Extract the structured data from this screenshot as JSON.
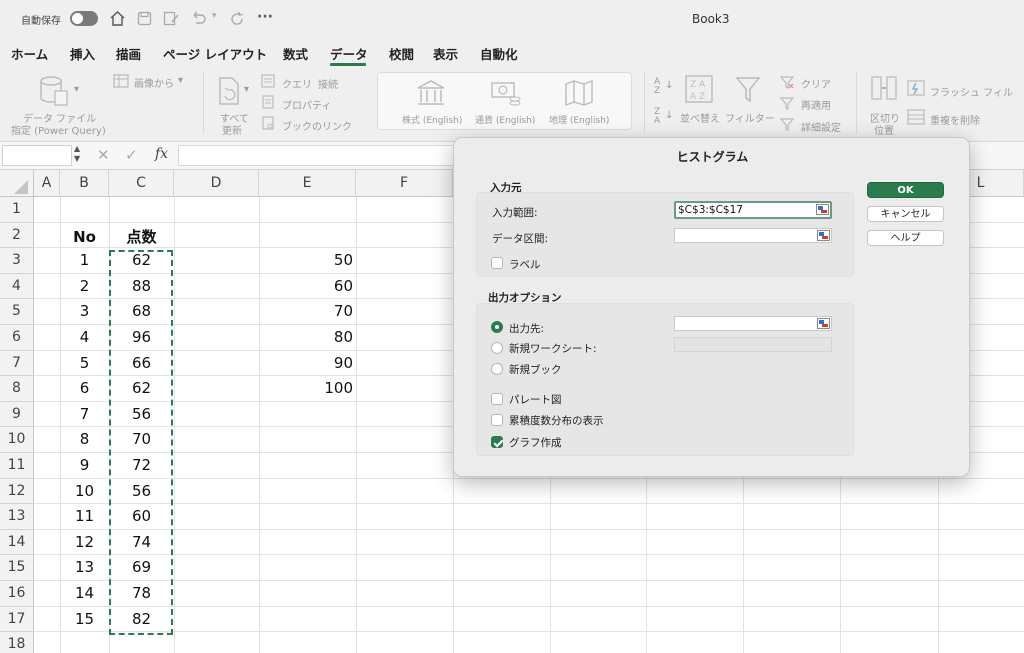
{
  "titlebar": {
    "autosave_label": "自動保存",
    "doc_title": "Book3"
  },
  "tabs": [
    "ホーム",
    "挿入",
    "描画",
    "ページ レイアウト",
    "数式",
    "データ",
    "校閲",
    "表示",
    "自動化"
  ],
  "active_tab": "データ",
  "ribbon": {
    "get_data_line1": "データ ファイル",
    "get_data_line2": "指定 (Power Query)",
    "from_image": "画像から",
    "refresh_line1": "すべて",
    "refresh_line2": "更新",
    "queries": "クエリ",
    "connections": "接続",
    "properties": "プロパティ",
    "workbook_links": "ブックのリンク",
    "stocks": "株式 (English)",
    "currencies": "通貨 (English)",
    "geography": "地理 (English)",
    "sort": "並べ替え",
    "filter": "フィルター",
    "clear": "クリア",
    "reapply": "再適用",
    "advanced": "詳細設定",
    "text_to_columns_line1": "区切り",
    "text_to_columns_line2": "位置",
    "flash_fill": "フラッシュ フィル",
    "remove_duplicates": "重複を削除"
  },
  "formula_bar": {
    "fx": "fx"
  },
  "sheet": {
    "col_headers": [
      "A",
      "B",
      "C",
      "D",
      "E",
      "F",
      "L"
    ],
    "row_headers": [
      "1",
      "2",
      "3",
      "4",
      "5",
      "6",
      "7",
      "8",
      "9",
      "10",
      "11",
      "12",
      "13",
      "14",
      "15",
      "16",
      "17",
      "18"
    ],
    "header_no": "No",
    "header_score": "点数",
    "no_values": [
      "1",
      "2",
      "3",
      "4",
      "5",
      "6",
      "7",
      "8",
      "9",
      "10",
      "11",
      "12",
      "13",
      "14",
      "15"
    ],
    "score_values": [
      "62",
      "88",
      "68",
      "96",
      "66",
      "62",
      "56",
      "70",
      "72",
      "56",
      "60",
      "74",
      "69",
      "78",
      "82"
    ],
    "bin_values": [
      "50",
      "60",
      "70",
      "80",
      "90",
      "100"
    ]
  },
  "dialog": {
    "title": "ヒストグラム",
    "input_section": "入力元",
    "input_range_label": "入力範囲:",
    "input_range_value": "$C$3:$C$17",
    "bin_range_label": "データ区間:",
    "bin_range_value": "",
    "labels_label": "ラベル",
    "output_section": "出力オプション",
    "output_range_label": "出力先:",
    "new_sheet_label": "新規ワークシート:",
    "new_book_label": "新規ブック",
    "pareto_label": "パレート図",
    "cumulative_label": "累積度数分布の表示",
    "chart_label": "グラフ作成",
    "ok": "OK",
    "cancel": "キャンセル",
    "help": "ヘルプ"
  },
  "colors": {
    "accent": "#2a7c4f",
    "marching_ants": "#2a7c4f"
  }
}
